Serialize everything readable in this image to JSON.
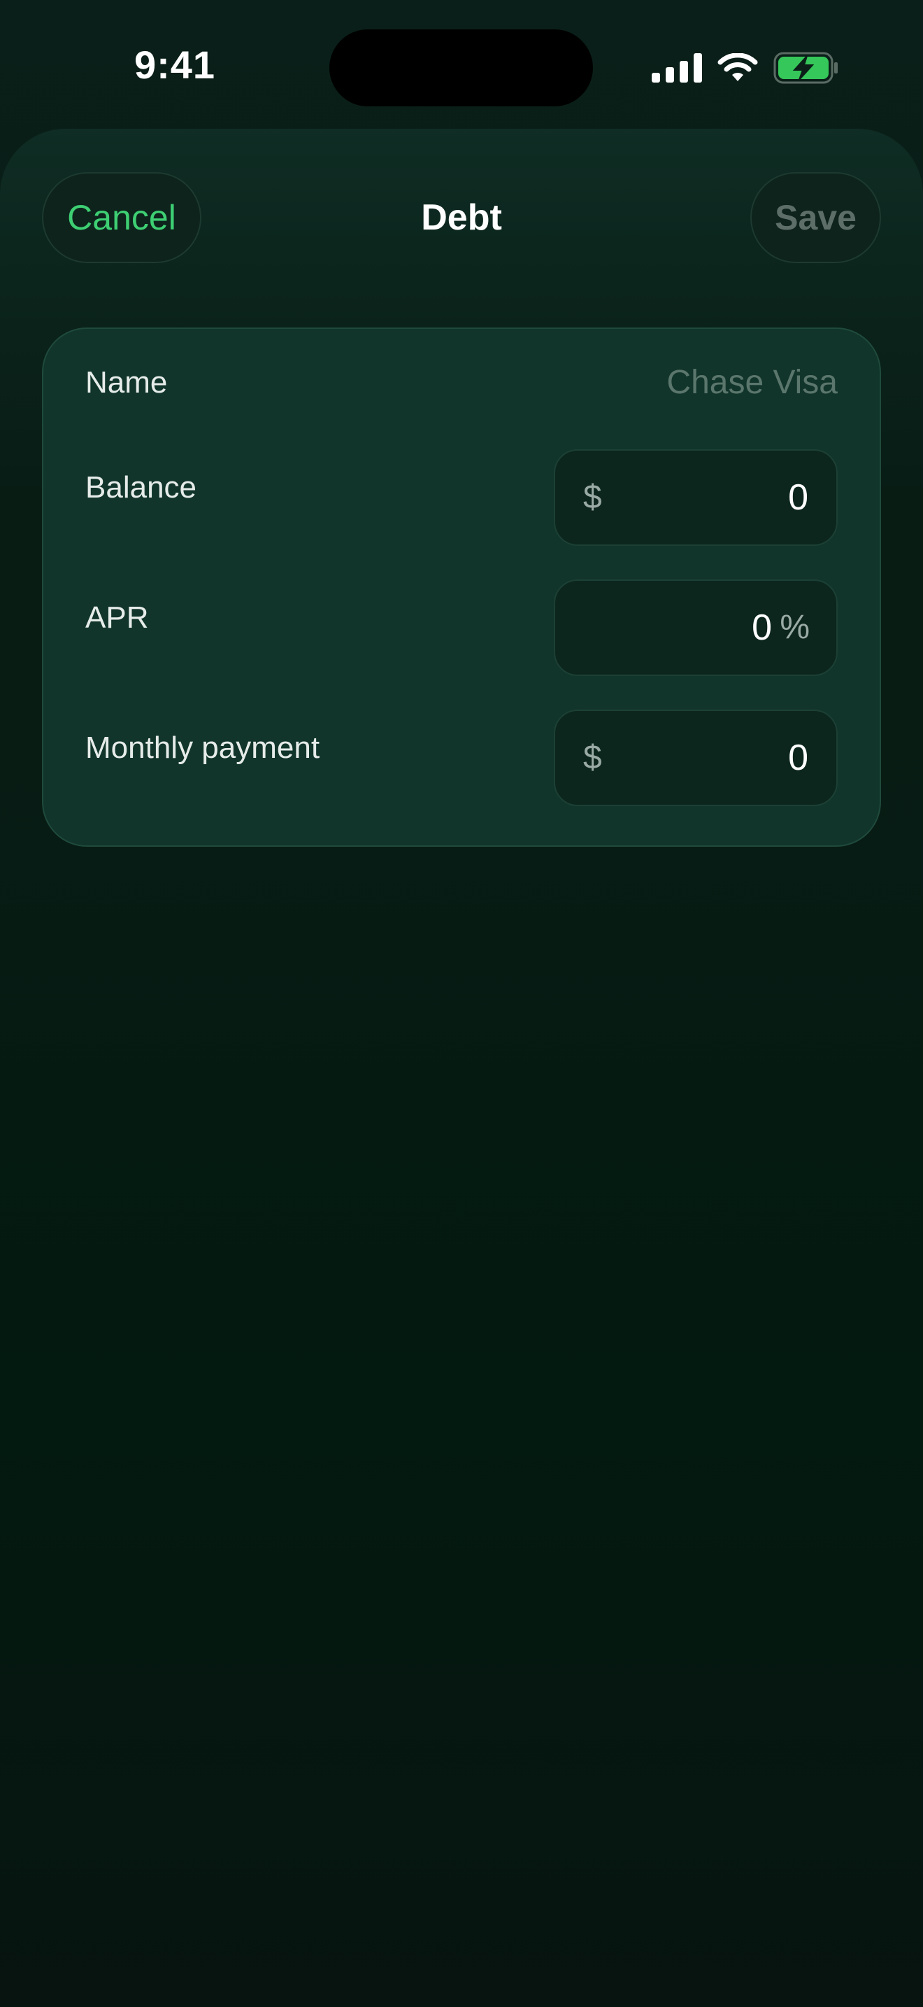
{
  "status_bar": {
    "time": "9:41",
    "icons": [
      "cellular-signal-icon",
      "wifi-icon",
      "battery-charging-icon"
    ],
    "battery_color": "#35c759"
  },
  "nav": {
    "cancel_label": "Cancel",
    "title": "Debt",
    "save_label": "Save"
  },
  "form": {
    "name": {
      "label": "Name",
      "value": "",
      "placeholder": "Chase Visa"
    },
    "balance": {
      "label": "Balance",
      "prefix": "$",
      "value": "0"
    },
    "apr": {
      "label": "APR",
      "value": "0",
      "suffix": "%"
    },
    "monthly_payment": {
      "label": "Monthly payment",
      "prefix": "$",
      "value": "0"
    }
  },
  "colors": {
    "accent": "#3ecf73",
    "disabled": "#5d6e68",
    "card": "#11352b",
    "field": "#0c261e"
  }
}
